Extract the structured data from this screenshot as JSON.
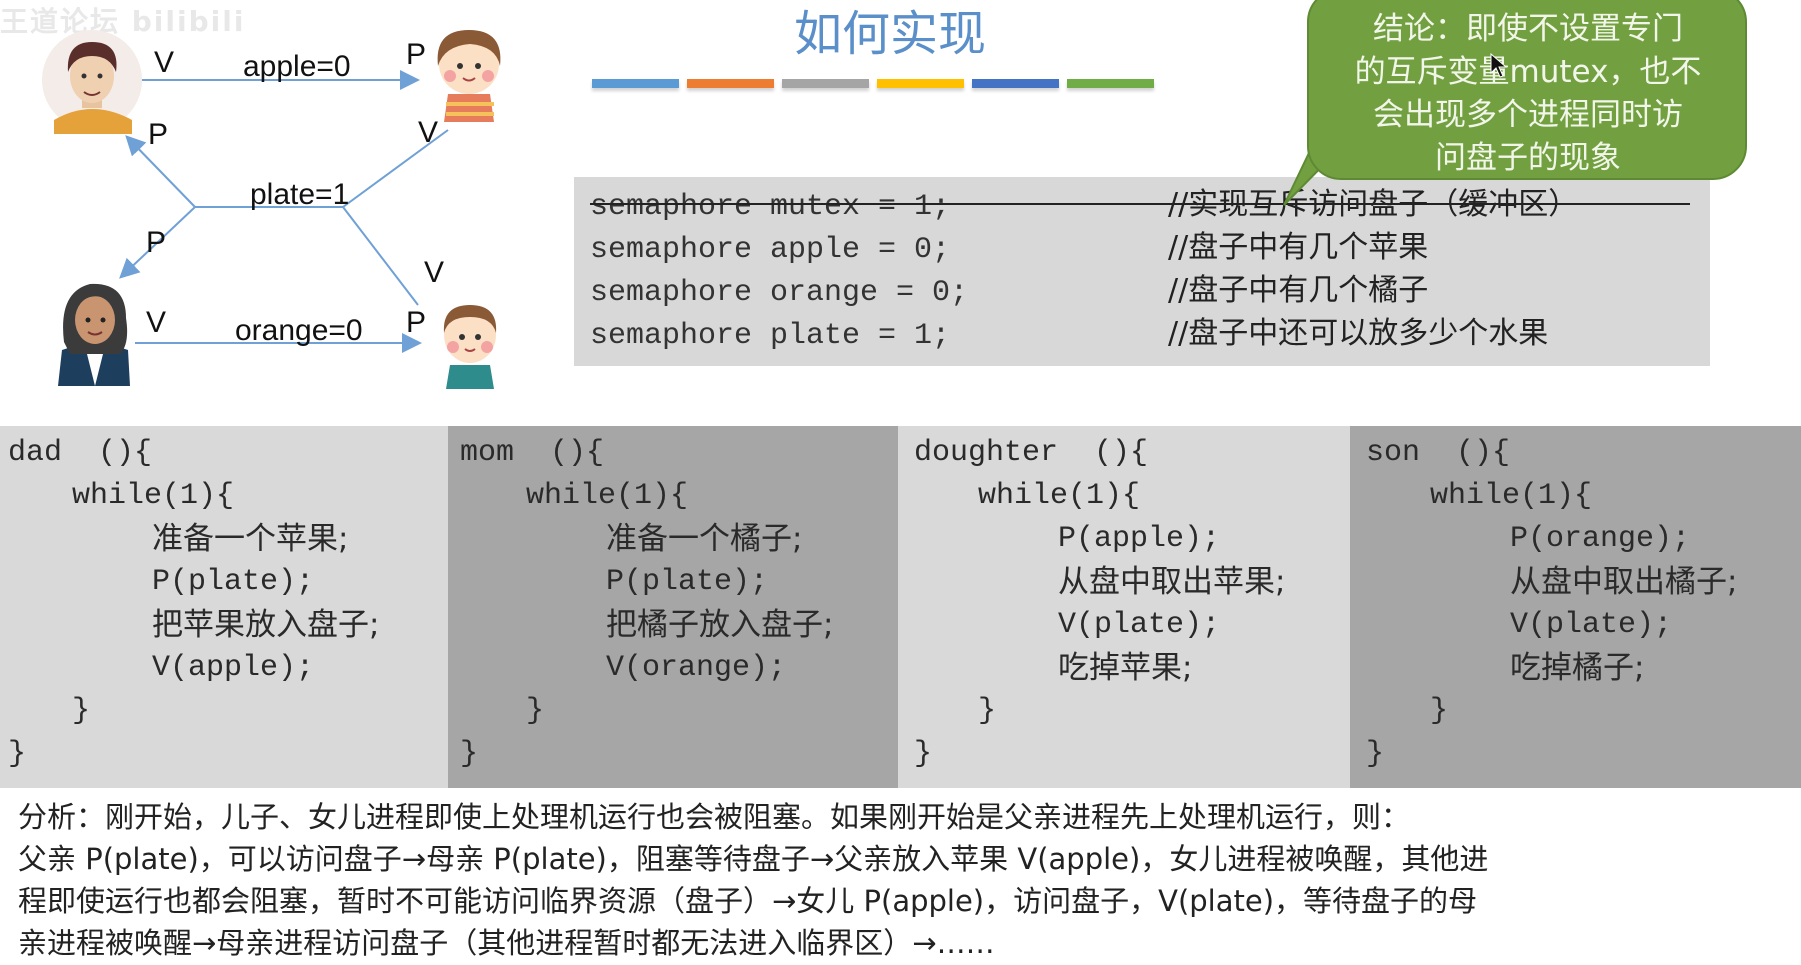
{
  "watermark": "王道论坛 bilibili",
  "slide": {
    "title": "如何实现",
    "accent_bars": [
      "#5b9bd5",
      "#ed7d31",
      "#a5a5a5",
      "#ffc000",
      "#4472c4",
      "#70ad47"
    ]
  },
  "diagram": {
    "dad_icon": "father-avatar",
    "daughter_icon": "daughter-avatar",
    "mom_icon": "mother-avatar",
    "son_icon": "son-avatar",
    "edges": {
      "apple_label": "apple=0",
      "orange_label": "orange=0",
      "plate_label": "plate=1",
      "dad_apple_op": "V",
      "daughter_apple_op": "P",
      "dad_plate_op": "P",
      "daughter_plate_op": "V",
      "mom_plate_op": "P",
      "son_plate_op": "V",
      "mom_orange_op": "V",
      "son_orange_op": "P"
    },
    "arrow_color": "#6fa0d6"
  },
  "callout": {
    "color": "#72a040",
    "lines": [
      "结论：即使不设置专门",
      "的互斥变量mutex，也不",
      "会出现多个进程同时访",
      "问盘子的现象"
    ]
  },
  "semaphores": [
    {
      "code": "semaphore mutex = 1;",
      "comment": "//实现互斥访问盘子（缓冲区）",
      "struck": true
    },
    {
      "code": "semaphore apple = 0;",
      "comment": "//盘子中有几个苹果",
      "struck": false
    },
    {
      "code": "semaphore orange = 0;",
      "comment": "//盘子中有几个橘子",
      "struck": false
    },
    {
      "code": "semaphore plate = 1;",
      "comment": "//盘子中还可以放多少个水果",
      "struck": false
    }
  ],
  "processes": [
    {
      "name": "dad",
      "header": "dad  (){",
      "loop": "while(1){",
      "body": [
        "准备一个苹果;",
        "P(plate);",
        "把苹果放入盘子;",
        "V(apple);"
      ],
      "close_inner": "}",
      "close_outer": "}"
    },
    {
      "name": "mom",
      "header": "mom  (){",
      "loop": "while(1){",
      "body": [
        "准备一个橘子;",
        "P(plate);",
        "把橘子放入盘子;",
        "V(orange);"
      ],
      "close_inner": "}",
      "close_outer": "}"
    },
    {
      "name": "doughter",
      "header": "doughter  (){",
      "loop": "while(1){",
      "body": [
        "P(apple);",
        "从盘中取出苹果;",
        "V(plate);",
        "吃掉苹果;"
      ],
      "close_inner": "}",
      "close_outer": "}"
    },
    {
      "name": "son",
      "header": "son  (){",
      "loop": "while(1){",
      "body": [
        "P(orange);",
        "从盘中取出橘子;",
        "V(plate);",
        "吃掉橘子;"
      ],
      "close_inner": "}",
      "close_outer": "}"
    }
  ],
  "analysis": {
    "lines": [
      "分析：刚开始，儿子、女儿进程即使上处理机运行也会被阻塞。如果刚开始是父亲进程先上处理机运行，则：",
      "父亲 P(plate)，可以访问盘子→母亲 P(plate)，阻塞等待盘子→父亲放入苹果 V(apple)，女儿进程被唤醒，其他进",
      "程即使运行也都会阻塞，暂时不可能访问临界资源（盘子）→女儿 P(apple)，访问盘子，V(plate)，等待盘子的母",
      "亲进程被唤醒→母亲进程访问盘子（其他进程暂时都无法进入临界区）→……"
    ]
  }
}
